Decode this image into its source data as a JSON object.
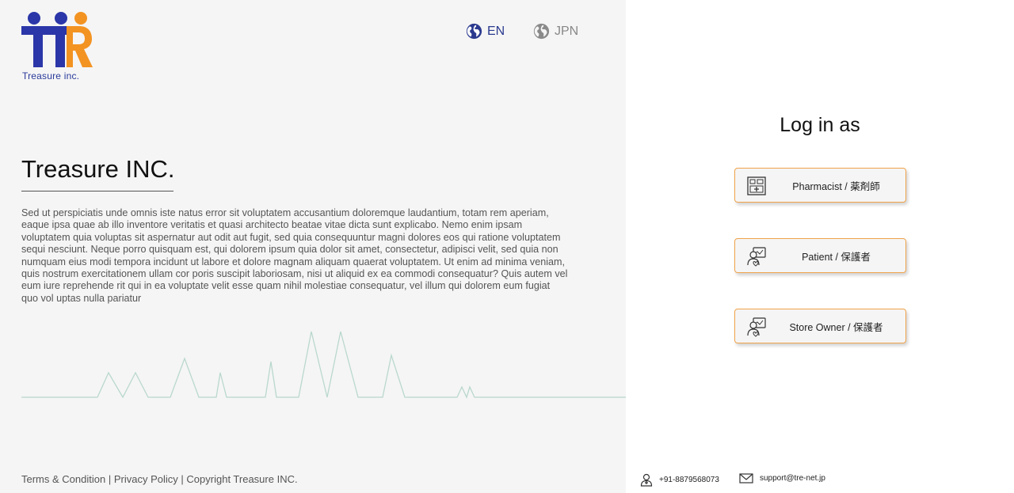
{
  "brand": {
    "name": "Treasure inc.",
    "colors": {
      "blue": "#2b36a8",
      "orange": "#f39322",
      "accent_border": "#f0a34a"
    }
  },
  "language": {
    "options": [
      {
        "label": "EN",
        "icon": "globe-icon",
        "active": true
      },
      {
        "label": "JPN",
        "icon": "globe-icon",
        "active": false
      }
    ]
  },
  "hero": {
    "title": "Treasure INC.",
    "body": "Sed ut perspiciatis unde omnis iste natus error sit voluptatem accusantium doloremque laudantium, totam rem aperiam, eaque ipsa quae ab illo inventore veritatis et quasi architecto beatae vitae dicta sunt explicabo. Nemo enim ipsam voluptatem quia voluptas sit aspernatur aut odit aut fugit, sed quia consequuntur magni dolores eos qui ratione voluptatem sequi nesciunt. Neque porro quisquam est, qui dolorem ipsum quia dolor sit amet, consectetur, adipisci velit, sed quia non numquam eius modi tempora incidunt ut labore et dolore magnam aliquam quaerat voluptatem. Ut enim ad minima veniam, quis nostrum exercitationem ullam cor poris suscipit laboriosam, nisi ut aliquid ex ea commodi consequatur? Quis autem vel eum iure reprehende rit qui in ea voluptate velit esse quam nihil molestiae consequatur, vel illum qui dolorem eum fugiat quo vol uptas nulla pariatur"
  },
  "footer": {
    "terms": "Terms & Condition",
    "privacy": "Privacy Policy",
    "copyright": "Copyright Treasure INC.",
    "separator": "|"
  },
  "login": {
    "title": "Log in as",
    "roles": [
      {
        "label": "Pharmacist / 薬剤師",
        "icon": "pharmacist-icon"
      },
      {
        "label": "Patient / 保護者",
        "icon": "patient-icon"
      },
      {
        "label": "Store Owner / 保護者",
        "icon": "store-owner-icon"
      }
    ]
  },
  "contact": {
    "phone": "+91-8879568073",
    "email": "support@tre-net.jp"
  }
}
